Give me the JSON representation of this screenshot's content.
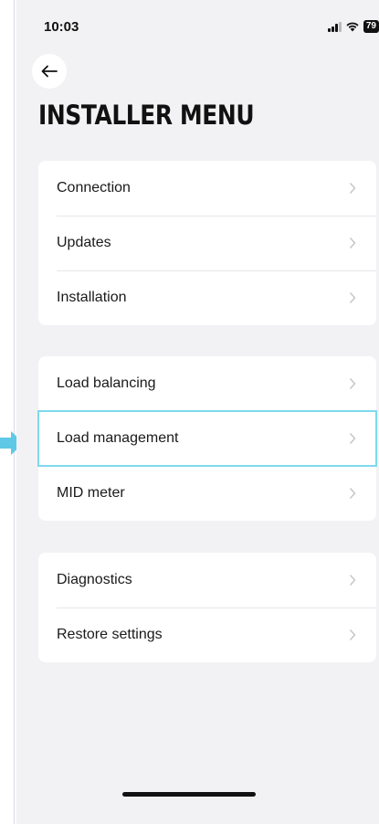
{
  "status_bar": {
    "time": "10:03",
    "battery": "79"
  },
  "header": {
    "title": "INSTALLER MENU",
    "back_icon": "arrow-left-icon"
  },
  "groups": [
    {
      "items": [
        {
          "label": "Connection"
        },
        {
          "label": "Updates"
        },
        {
          "label": "Installation"
        }
      ]
    },
    {
      "items": [
        {
          "label": "Load balancing"
        },
        {
          "label": "Load management"
        },
        {
          "label": "MID meter"
        }
      ]
    },
    {
      "items": [
        {
          "label": "Diagnostics"
        },
        {
          "label": "Restore settings"
        }
      ]
    }
  ],
  "colors": {
    "highlight": "#7fd9ec",
    "pointer": "#5fc8e6",
    "background": "#f2f2f4"
  }
}
